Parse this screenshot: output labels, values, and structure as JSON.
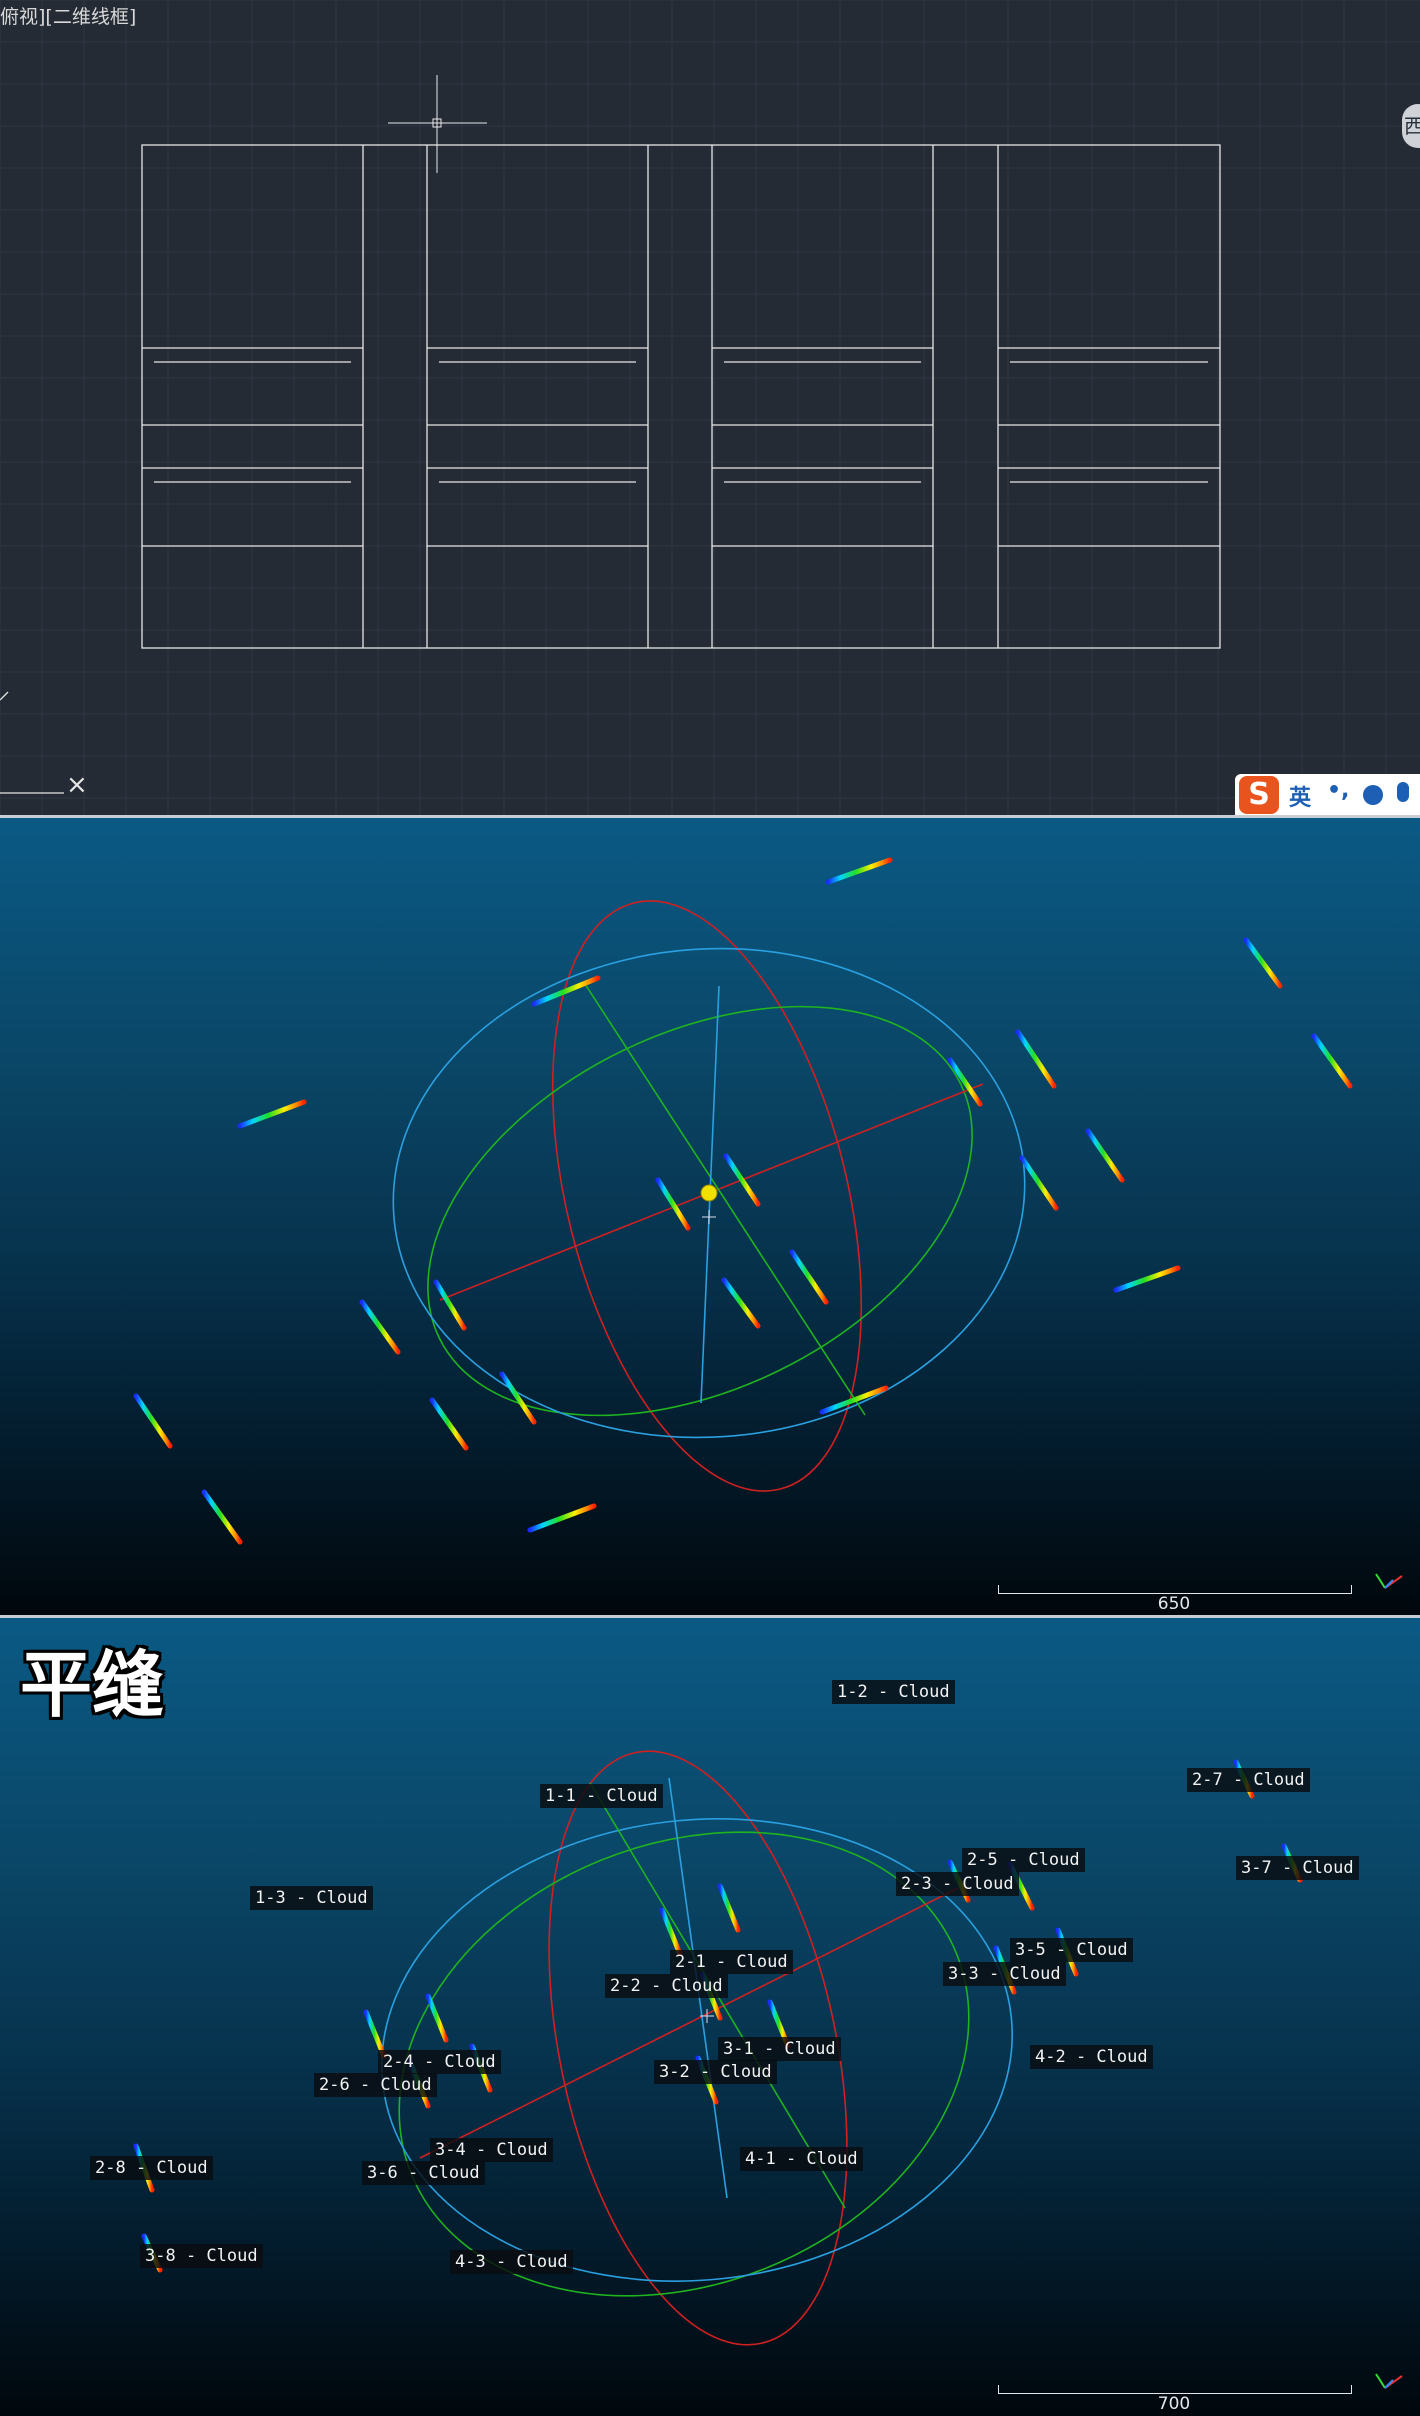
{
  "cad": {
    "view_label": "俯视][二维线框]",
    "viewcube_face": "西",
    "ime": {
      "logo": "S",
      "lang": "英",
      "punct": "•,",
      "emoji_icon": "smile-icon",
      "mic_icon": "microphone-icon"
    },
    "ucs_close": "×"
  },
  "viewport1": {
    "scale_label": "650"
  },
  "viewport2": {
    "title": "平缝",
    "scale_label": "700",
    "cloud_labels": [
      "1-2 - Cloud",
      "1-1 - Cloud",
      "1-3 - Cloud",
      "2-7 - Cloud",
      "3-7 - Cloud",
      "2-5 - Cloud",
      "2-3 - Cloud",
      "2-1 - Cloud",
      "2-2 - Cloud",
      "3-5 - Cloud",
      "3-3 - Cloud",
      "2-4 - Cloud",
      "2-6 - Cloud",
      "3-1 - Cloud",
      "3-2 - Cloud",
      "4-2 - Cloud",
      "2-8 - Cloud",
      "3-4 - Cloud",
      "3-6 - Cloud",
      "4-1 - Cloud",
      "3-8 - Cloud",
      "4-3 - Cloud"
    ]
  },
  "colors": {
    "cad_bg": "#252b35",
    "ellipse_red": "#d02020",
    "ellipse_green": "#1fb31f",
    "ellipse_blue": "#2aa0e0",
    "centroid": "#f2e000"
  }
}
